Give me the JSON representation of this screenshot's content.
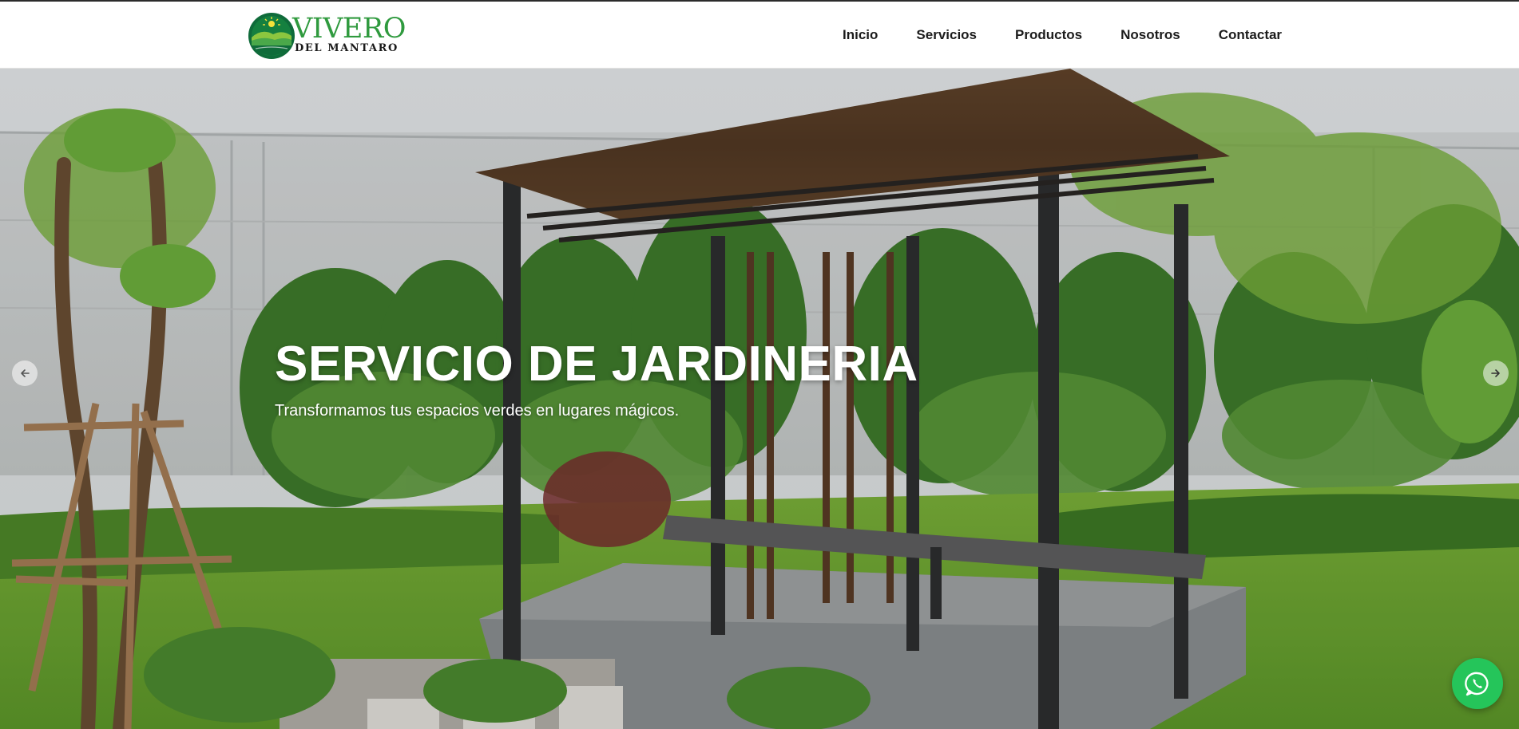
{
  "brand": {
    "name_line1": "VIVERO",
    "name_line2": "DEL MANTARO",
    "logo_icon": "sun-over-green-hills-logo",
    "primary_green": "#2f9a3e",
    "dark_green": "#0f6b3a"
  },
  "nav": {
    "items": [
      {
        "label": "Inicio"
      },
      {
        "label": "Servicios"
      },
      {
        "label": "Productos"
      },
      {
        "label": "Nosotros"
      },
      {
        "label": "Contactar"
      }
    ]
  },
  "hero": {
    "title": "SERVICIO DE JARDINERIA",
    "subtitle": "Transformamos tus espacios verdes en lugares mágicos.",
    "prev_icon": "arrow-left-icon",
    "next_icon": "arrow-right-icon"
  },
  "floating": {
    "whatsapp_icon": "whatsapp-icon",
    "whatsapp_color": "#25c55a"
  }
}
